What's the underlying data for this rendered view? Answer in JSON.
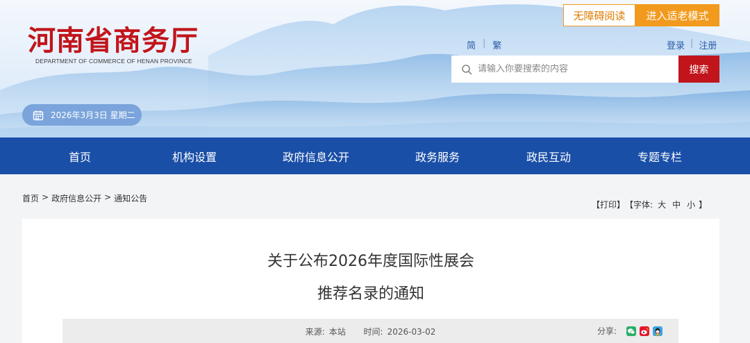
{
  "header": {
    "site_name_cn": "河南省商务厅",
    "site_name_en": "DEPARTMENT OF COMMERCE OF HENAN PROVINCE",
    "accessibility_label": "无障碍阅读",
    "elder_mode_label": "进入适老模式",
    "lang_simplified": "简",
    "lang_separator": "|",
    "lang_traditional": "繁",
    "login_label": "登录",
    "auth_separator": "|",
    "register_label": "注册",
    "search": {
      "placeholder": "请输入你要搜索的内容",
      "value": "",
      "button_label": "搜索"
    },
    "date_text": "2026年3月3日 星期二",
    "brand_color": "#c1151b",
    "accent_color": "#f29a1d"
  },
  "nav": {
    "color": "#1a4fa8",
    "items": [
      {
        "label": "首页"
      },
      {
        "label": "机构设置"
      },
      {
        "label": "政府信息公开"
      },
      {
        "label": "政务服务"
      },
      {
        "label": "政民互动"
      },
      {
        "label": "专题专栏"
      }
    ]
  },
  "breadcrumb": {
    "items": [
      "首页",
      "政府信息公开",
      "通知公告"
    ],
    "separator": ">"
  },
  "tools": {
    "print_label": "【打印】",
    "font_label": "【字体:",
    "font_large": "大",
    "font_medium": "中",
    "font_small": "小",
    "font_close": "】"
  },
  "article": {
    "title_line1": "关于公布2026年度国际性展会",
    "title_line2": "推荐名录的通知",
    "source_label": "来源:",
    "source_value": "本站",
    "time_label": "时间:",
    "time_value": "2026-03-02",
    "share_label": "分享:",
    "share_icons": [
      "wechat-icon",
      "weibo-icon",
      "qq-icon"
    ]
  }
}
